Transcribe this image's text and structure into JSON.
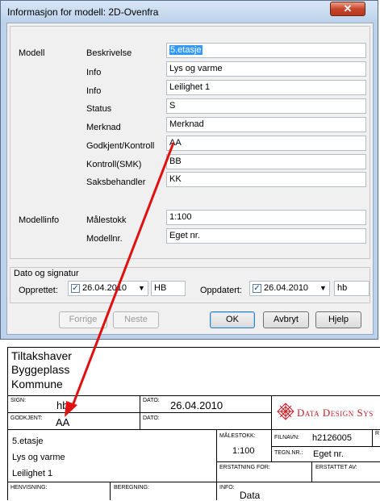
{
  "dialog": {
    "title": "Informasjon for modell: 2D-Ovenfra",
    "close_symbol": "✕",
    "sections": {
      "model": "Modell",
      "modelinfo": "Modellinfo"
    },
    "fields": [
      {
        "label": "Beskrivelse",
        "value": "5.etasje"
      },
      {
        "label": "Info",
        "value": "Lys og varme"
      },
      {
        "label": "Info",
        "value": "Leilighet 1"
      },
      {
        "label": "Status",
        "value": "S"
      },
      {
        "label": "Merknad",
        "value": "Merknad"
      },
      {
        "label": "Godkjent/Kontroll",
        "value": "AA"
      },
      {
        "label": "Kontroll(SMK)",
        "value": "BB"
      },
      {
        "label": "Saksbehandler",
        "value": "KK"
      }
    ],
    "info_fields": [
      {
        "label": "Målestokk",
        "value": "1:100"
      },
      {
        "label": "Modellnr.",
        "value": "Eget nr."
      }
    ],
    "date_group": {
      "title": "Dato og signatur",
      "created_label": "Opprettet:",
      "created_date": "26.04.2010",
      "created_sign": "HB",
      "updated_label": "Oppdatert:",
      "updated_date": "26.04.2010",
      "updated_sign": "hb"
    },
    "buttons": {
      "prev": "Forrige",
      "next": "Neste",
      "ok": "OK",
      "cancel": "Avbryt",
      "help": "Hjelp"
    }
  },
  "sheet": {
    "client_lines": [
      "Tiltakshaver",
      "Byggeplass",
      "Kommune"
    ],
    "sign_label": "SIGN:",
    "sign_value": "hb",
    "date_label": "DATO:",
    "date_value": "26.04.2010",
    "approved_label": "GODKJENT:",
    "approved_value": "AA",
    "approved_date_label": "DATO:",
    "company": "Data Design Sys",
    "description_lines": [
      "5.etasje",
      "Lys og varme",
      "Leilighet 1"
    ],
    "scale_label": "MÅLESTOKK:",
    "scale_value": "1:100",
    "file_label": "FILNAVN:",
    "file_value": "h2126005",
    "drawing_label": "TEGN.NR.:",
    "drawing_value": "Eget nr.",
    "r_label": "R",
    "replaces_label": "ERSTATNING FOR:",
    "replaced_label": "ERSTATTET AV:",
    "reference_label": "HENVISNING:",
    "calc_label": "BEREGNING:",
    "info_label": "INFO:",
    "info_value": "Data"
  },
  "colors": {
    "arrow": "#e01010",
    "selection": "#3399ff",
    "company": "#c0202a"
  }
}
